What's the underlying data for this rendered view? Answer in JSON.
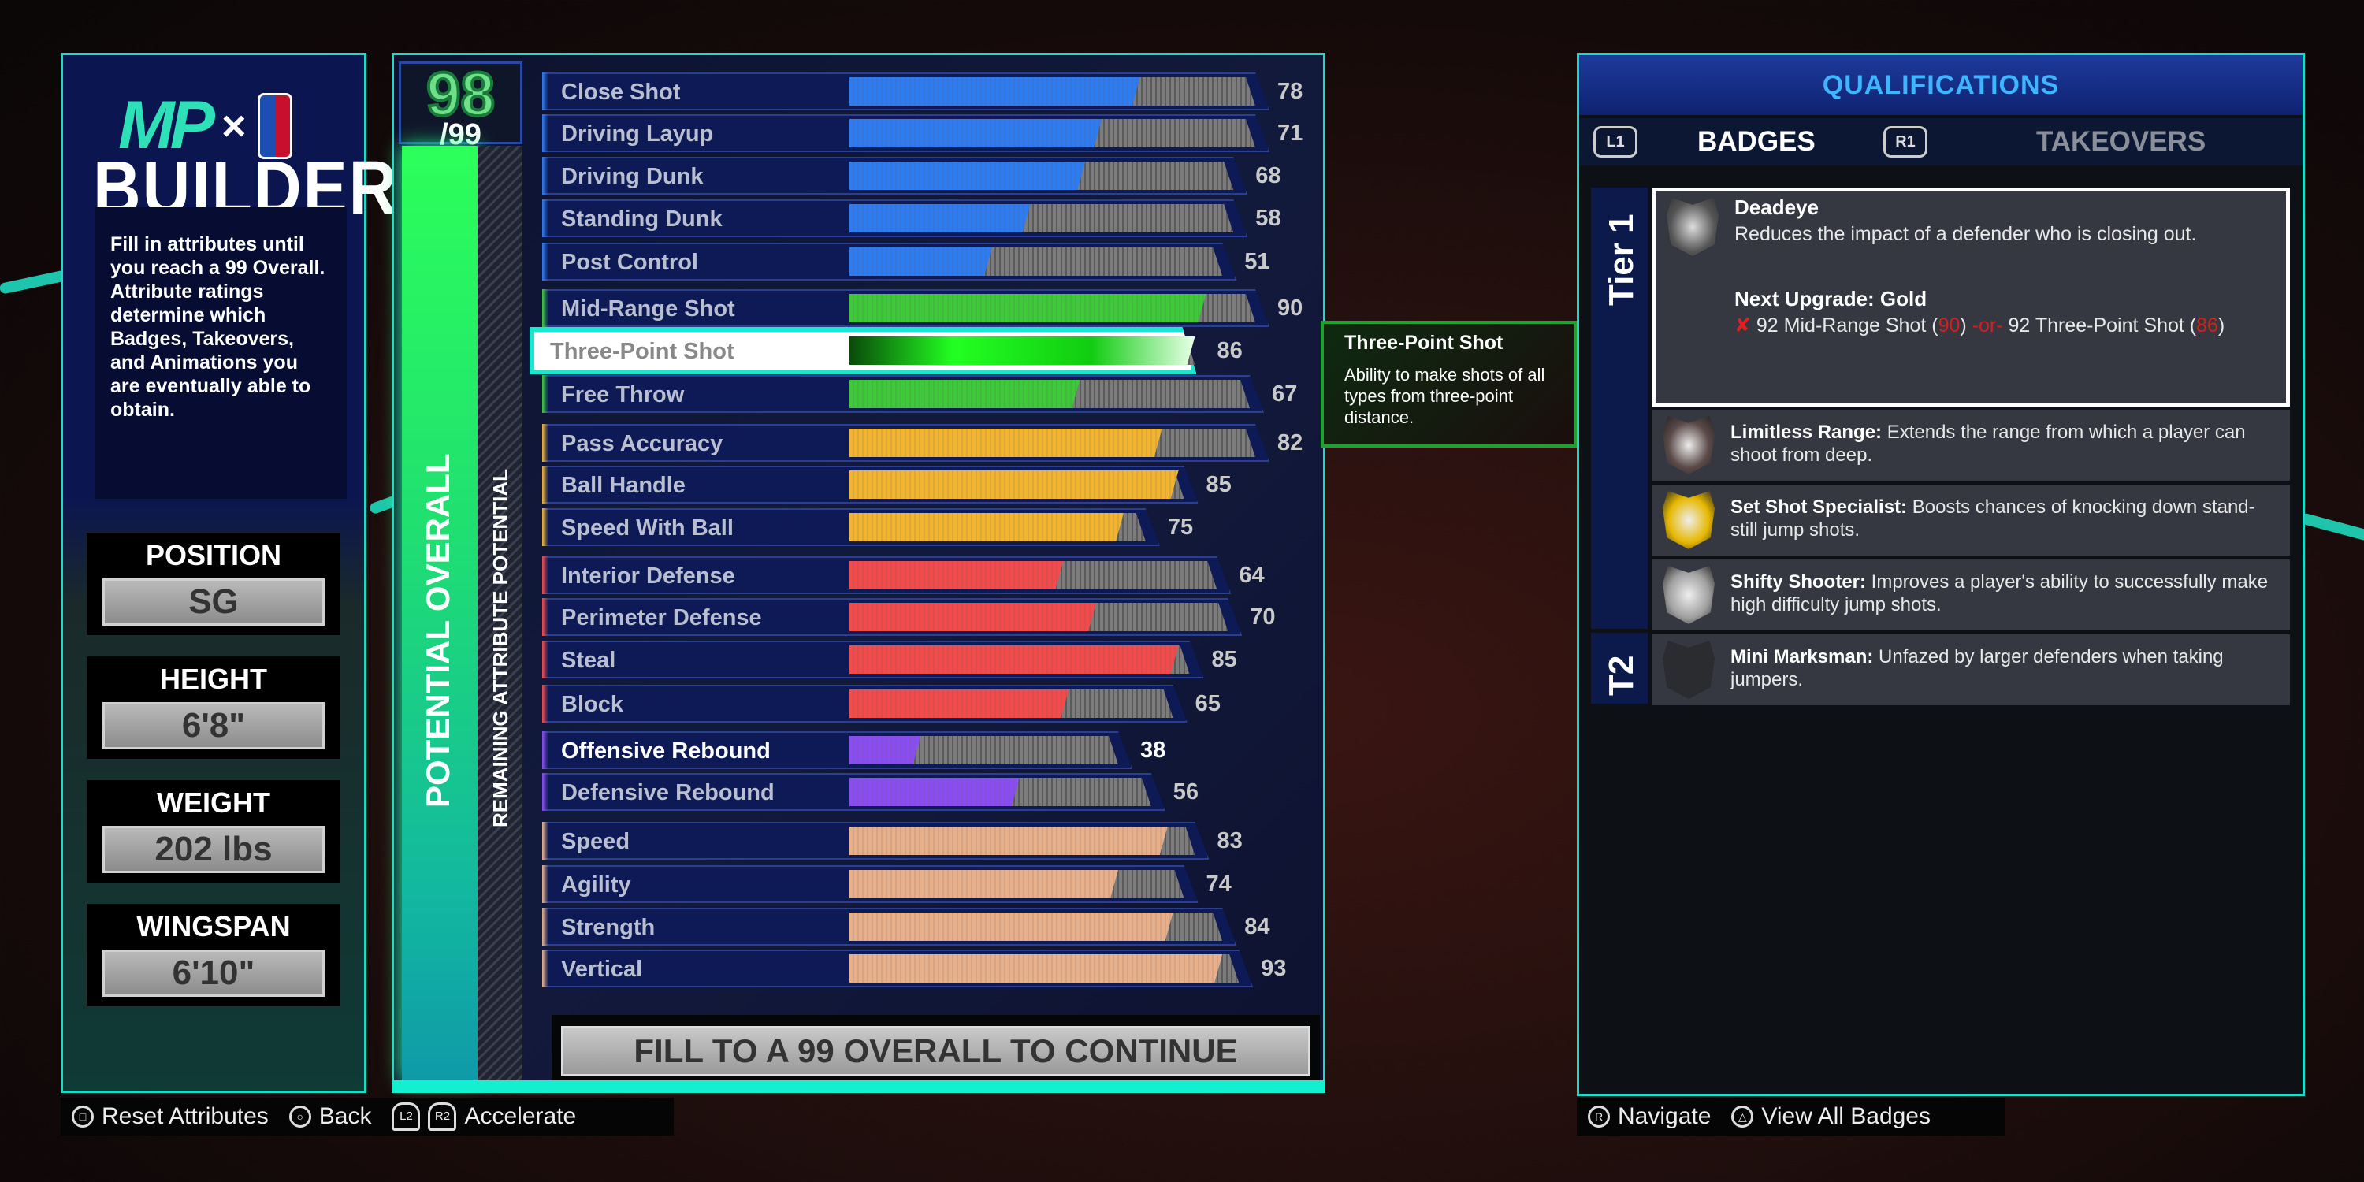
{
  "left": {
    "logo": {
      "brand": "MP",
      "x": "×",
      "partner": "NBA"
    },
    "title": "BUILDER",
    "description": "Fill in attributes until you reach a 99 Overall. Attribute ratings determine which Badges, Takeovers, and Animations you are eventually able to obtain.",
    "info": [
      {
        "label": "POSITION",
        "value": "SG"
      },
      {
        "label": "HEIGHT",
        "value": "6'8\""
      },
      {
        "label": "WEIGHT",
        "value": "202 lbs"
      },
      {
        "label": "WINGSPAN",
        "value": "6'10\""
      }
    ]
  },
  "overall": {
    "value": "98",
    "max": "/99",
    "label": "POTENTIAL OVERALL",
    "remaining_label": "REMAINING ATTRIBUTE POTENTIAL"
  },
  "colors": {
    "inside": "#2f7bf0",
    "shooting": "#3ec83a",
    "playmaking": "#f2b431",
    "defense": "#f24b4b",
    "rebounding": "#8a4ef0",
    "athleticism": "#e8b08a",
    "accent": "#1fd9c4"
  },
  "attributes": [
    {
      "name": "Close Shot",
      "value": 78,
      "cap": 99,
      "group": "inside"
    },
    {
      "name": "Driving Layup",
      "value": 71,
      "cap": 99,
      "group": "inside"
    },
    {
      "name": "Driving Dunk",
      "value": 68,
      "cap": 95,
      "group": "inside"
    },
    {
      "name": "Standing Dunk",
      "value": 58,
      "cap": 95,
      "group": "inside"
    },
    {
      "name": "Post Control",
      "value": 51,
      "cap": 93,
      "group": "inside"
    },
    {
      "name": "Mid-Range Shot",
      "value": 90,
      "cap": 99,
      "group": "shooting"
    },
    {
      "name": "Three-Point Shot",
      "value": 86,
      "cap": 88,
      "group": "shooting",
      "selected": true
    },
    {
      "name": "Free Throw",
      "value": 67,
      "cap": 98,
      "group": "shooting"
    },
    {
      "name": "Pass Accuracy",
      "value": 82,
      "cap": 99,
      "group": "playmaking"
    },
    {
      "name": "Ball Handle",
      "value": 85,
      "cap": 86,
      "group": "playmaking"
    },
    {
      "name": "Speed With Ball",
      "value": 75,
      "cap": 79,
      "group": "playmaking"
    },
    {
      "name": "Interior Defense",
      "value": 64,
      "cap": 92,
      "group": "defense"
    },
    {
      "name": "Perimeter Defense",
      "value": 70,
      "cap": 94,
      "group": "defense"
    },
    {
      "name": "Steal",
      "value": 85,
      "cap": 87,
      "group": "defense"
    },
    {
      "name": "Block",
      "value": 65,
      "cap": 84,
      "group": "defense"
    },
    {
      "name": "Offensive Rebound",
      "value": 38,
      "cap": 74,
      "group": "rebounding",
      "highlight": true
    },
    {
      "name": "Defensive Rebound",
      "value": 56,
      "cap": 80,
      "group": "rebounding"
    },
    {
      "name": "Speed",
      "value": 83,
      "cap": 88,
      "group": "athleticism"
    },
    {
      "name": "Agility",
      "value": 74,
      "cap": 86,
      "group": "athleticism"
    },
    {
      "name": "Strength",
      "value": 84,
      "cap": 93,
      "group": "athleticism"
    },
    {
      "name": "Vertical",
      "value": 93,
      "cap": 96,
      "group": "athleticism"
    }
  ],
  "continue_button": "FILL TO A 99 OVERALL TO CONTINUE",
  "tooltip": {
    "title": "Three-Point Shot",
    "description": "Ability to make shots of all types from three-point distance."
  },
  "qualifications": {
    "header": "QUALIFICATIONS",
    "tabs": [
      {
        "button": "L1",
        "label": "BADGES",
        "active": true
      },
      {
        "button": "R1",
        "label": "TAKEOVERS",
        "active": false
      }
    ],
    "tiers": [
      "Tier 1",
      "T2"
    ],
    "selected_badge": {
      "name": "Deadeye",
      "description": "Reduces the impact of a defender who is closing out.",
      "next_upgrade": "Next Upgrade: Gold",
      "req_mark": "✘",
      "req1": "92 Mid-Range Shot (",
      "req1_current": "90",
      "req_or": "-or-",
      "req2": "92 Three-Point Shot (",
      "req2_current": "86",
      "close_paren": ")"
    },
    "badges": [
      {
        "name": "Limitless Range:",
        "description": "Extends the range from which a player can shoot from deep.",
        "tier_color": "#5a4a48"
      },
      {
        "name": "Set Shot Specialist:",
        "description": "Boosts chances of knocking down stand-still jump shots.",
        "tier_color": "#e6b800"
      },
      {
        "name": "Shifty Shooter:",
        "description": "Improves a player's ability to successfully make high difficulty jump shots.",
        "tier_color": "#a0a0a0"
      },
      {
        "name": "Mini Marksman:",
        "description": "Unfazed by larger defenders when taking jumpers.",
        "tier_color": "#2a2c30"
      }
    ]
  },
  "hints_left": [
    {
      "button": "□",
      "label": "Reset Attributes"
    },
    {
      "button": "○",
      "label": "Back"
    },
    {
      "button": "L2",
      "button2": "R2",
      "label": "Accelerate"
    }
  ],
  "hints_right": [
    {
      "button": "R",
      "label": "Navigate"
    },
    {
      "button": "△",
      "label": "View All Badges"
    }
  ]
}
